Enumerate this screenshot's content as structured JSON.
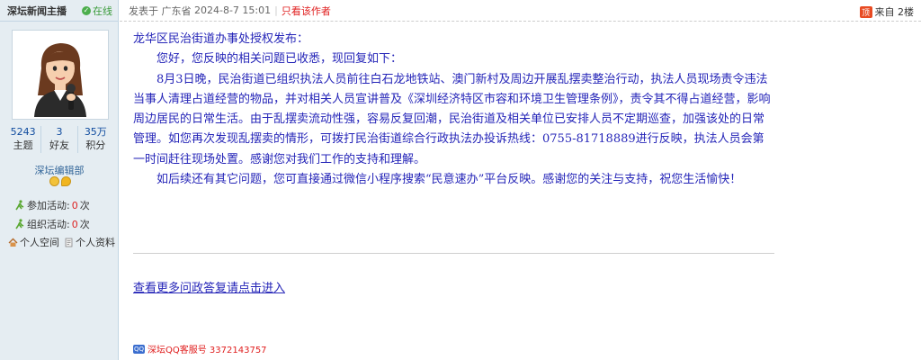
{
  "author": {
    "name": "深坛新闻主播",
    "online_label": "在线",
    "stats": [
      {
        "value": "5243",
        "label": "主题"
      },
      {
        "value": "3",
        "label": "好友"
      },
      {
        "value": "35万",
        "label": "积分"
      }
    ],
    "group": "深坛编辑部",
    "activities": [
      {
        "label": "参加活动:",
        "count": "0",
        "unit": "次"
      },
      {
        "label": "组织活动:",
        "count": "0",
        "unit": "次"
      }
    ],
    "space_label": "个人空间",
    "profile_label": "个人资料"
  },
  "post_header": {
    "posted_prefix": "发表于",
    "location": "广东省",
    "datetime": "2024-8-7 15:01",
    "only_author": "只看该作者",
    "floor_badge": "顶",
    "floor_label": "来自 2楼"
  },
  "post": {
    "title_line": "龙华区民治街道办事处授权发布：",
    "greeting": "您好，您反映的相关问题已收悉，现回复如下：",
    "body": "8月3日晚，民治街道已组织执法人员前往白石龙地铁站、澳门新村及周边开展乱摆卖整治行动，执法人员现场责令违法当事人清理占道经营的物品，并对相关人员宣讲普及《深圳经济特区市容和环境卫生管理条例》，责令其不得占道经营，影响周边居民的日常生活。由于乱摆卖流动性强，容易反复回潮，民治街道及相关单位已安排人员不定期巡查，加强该处的日常管理。如您再次发现乱摆卖的情形，可拨打民治街道综合行政执法办投诉热线：0755-81718889进行反映，执法人员会第一时间赶往现场处置。感谢您对我们工作的支持和理解。",
    "closing": "如后续还有其它问题，您可直接通过微信小程序搜索“民意速办”平台反映。感谢您的关注与支持，祝您生活愉快！",
    "more_link": "查看更多问政答复请点击进入"
  },
  "service": {
    "icon_text": "QQ",
    "label": "深坛QQ客服号 3372143757"
  },
  "colors": {
    "sidebar_bg": "#e5edf2",
    "body_text": "#2525b8",
    "accent_red": "#e02020",
    "online_green": "#4cae4c"
  }
}
